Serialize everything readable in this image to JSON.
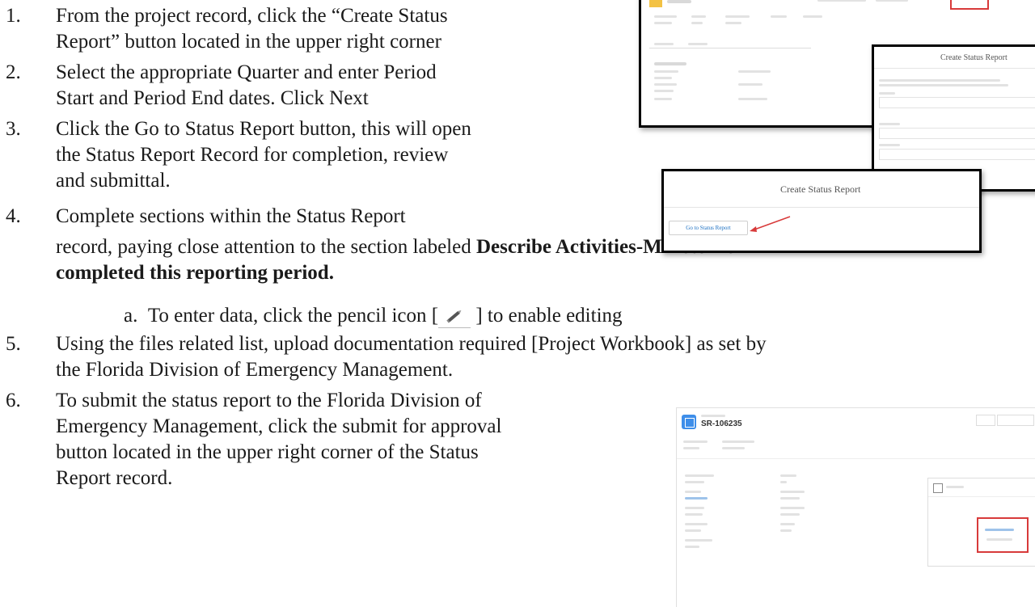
{
  "steps": [
    {
      "num": "1.",
      "lines": [
        "From the project record, click the “Create Status",
        "Report” button located in the upper right corner"
      ]
    },
    {
      "num": "2.",
      "lines": [
        "Select the appropriate Quarter and enter Period",
        "Start and Period End dates.  Click Next"
      ]
    },
    {
      "num": "3.",
      "lines": [
        "Click the Go to Status Report button, this will open",
        "the Status Report Record for completion, review",
        "and submittal."
      ]
    },
    {
      "num": "4.",
      "line1": "Complete sections within the Status Report",
      "line2": "record, paying close attention to the section labeled ",
      "bold1": "Describe Activities-Milestones",
      "bold2": "completed this reporting period."
    },
    {
      "num": "5.",
      "lines": [
        "Using the files related list, upload documentation required [Project Workbook] as set by",
        "the Florida Division of Emergency Management."
      ]
    },
    {
      "num": "6.",
      "lines": [
        "To submit the status report to the Florida Division of",
        "Emergency Management, click the submit for approval",
        "button located in the upper right corner of the Status",
        "Report record."
      ]
    }
  ],
  "substep": {
    "label": "a.",
    "before": "To enter data, click the pencil icon [",
    "after": " ] to enable editing"
  },
  "screens": {
    "create_status_report_modal": "Create Status Report",
    "create_status_report_small": "Create Status Report",
    "go_button": "Go to Status Report",
    "record_id": "SR-106235"
  },
  "colors": {
    "highlight": "#d83a3a",
    "sf_blue": "#3e8ee9"
  }
}
